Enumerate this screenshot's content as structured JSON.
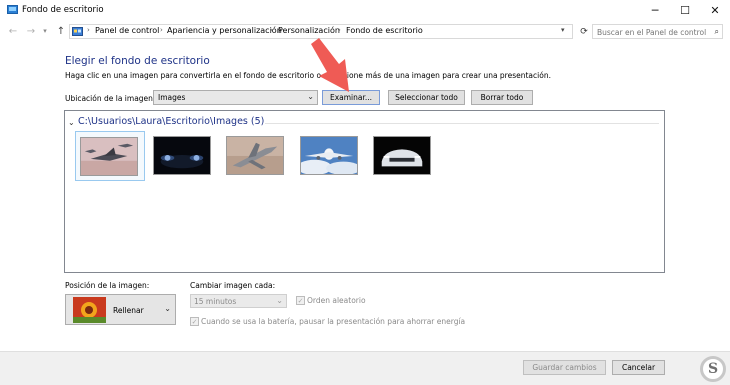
{
  "window": {
    "title": "Fondo de escritorio",
    "controls": {
      "minimize": "─",
      "maximize": "☐",
      "close": "✕"
    }
  },
  "address_bar": {
    "breadcrumbs": [
      "Panel de control",
      "Apariencia y personalización",
      "Personalización",
      "Fondo de escritorio"
    ],
    "search_placeholder": "Buscar en el Panel de control"
  },
  "main": {
    "heading": "Elegir el fondo de escritorio",
    "instructions": "Haga clic en una imagen para convertirla en el fondo de escritorio o seleccione más de una imagen para crear una presentación.",
    "location_label": "Ubicación de la imagen:",
    "location_value": "Images",
    "buttons": {
      "browse": "Examinar...",
      "select_all": "Seleccionar todo",
      "clear_all": "Borrar todo"
    },
    "folder": {
      "label": "C:\\Usuarios\\Laura\\Escritorio\\Images (5)",
      "thumbnails": [
        {
          "name": "jets-formation",
          "selected": true
        },
        {
          "name": "car-headlights-dark",
          "selected": false
        },
        {
          "name": "fighter-jet-sky",
          "selected": false
        },
        {
          "name": "airliner-clouds",
          "selected": false
        },
        {
          "name": "white-car-dark",
          "selected": false
        }
      ]
    }
  },
  "options": {
    "position_label": "Posición de la imagen:",
    "position_value": "Rellenar",
    "change_label": "Cambiar imagen cada:",
    "interval_value": "15 minutos",
    "shuffle_label": "Orden aleatorio",
    "shuffle_checked": true,
    "battery_label": "Cuando se usa la batería, pausar la presentación para ahorrar energía",
    "battery_checked": true
  },
  "footer": {
    "save": "Guardar cambios",
    "cancel": "Cancelar"
  },
  "watermark": {
    "letter": "S",
    "brand": "Solvetic"
  },
  "colors": {
    "heading": "#1e3287",
    "arrow": "#ef5b55",
    "selection": "#99c9ef"
  }
}
